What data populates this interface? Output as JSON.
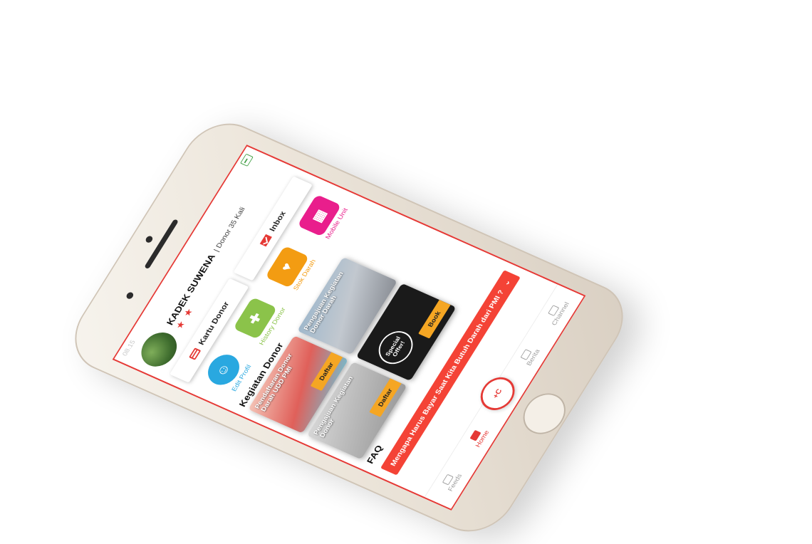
{
  "status": {
    "time": "08.15"
  },
  "profile": {
    "name": "KADEK SUWENA",
    "donor_count": "| Donor 35 Kali",
    "stars": "★ ★"
  },
  "buttons": {
    "kartu_donor": "Kartu Donor",
    "inbox": "Inbox"
  },
  "menu": [
    {
      "label": "Edit Profil",
      "icon": "headset-avatar-icon",
      "color": "#29a8e0"
    },
    {
      "label": "History Donor",
      "icon": "clipboard-icon",
      "color": "#8bc34a"
    },
    {
      "label": "Stok Darah",
      "icon": "blood-bag-icon",
      "color": "#f39c12"
    },
    {
      "label": "Mobile Unit",
      "icon": "calendar-icon",
      "color": "#e91e8c"
    }
  ],
  "section": {
    "kegiatan_title": "Kegiatan Donor",
    "faq_title": "FAQ"
  },
  "events": [
    {
      "title": "Pendaftaran Donor Darah UDD PMI",
      "button": "Daftar"
    },
    {
      "title": "Pengajuan Kegiatan Donor Darah",
      "button": ""
    },
    {
      "title": "Pengajuan Kegiatan Donor",
      "button": "Daftar"
    },
    {
      "title": "Special Offer!",
      "button": "Book"
    }
  ],
  "faq": {
    "question": "Mengapa Harus Bayar Saat Kita Butuh Darah dari PMI ?",
    "chevron": "⌄"
  },
  "tabs": [
    {
      "label": "Feeds",
      "active": false
    },
    {
      "label": "Home",
      "active": true
    },
    {
      "label": "Berita",
      "active": false
    },
    {
      "label": "Channel",
      "active": false
    }
  ],
  "logo": {
    "text": "+C"
  },
  "colors": {
    "primary": "#e53935",
    "accent": "#f5a623"
  }
}
